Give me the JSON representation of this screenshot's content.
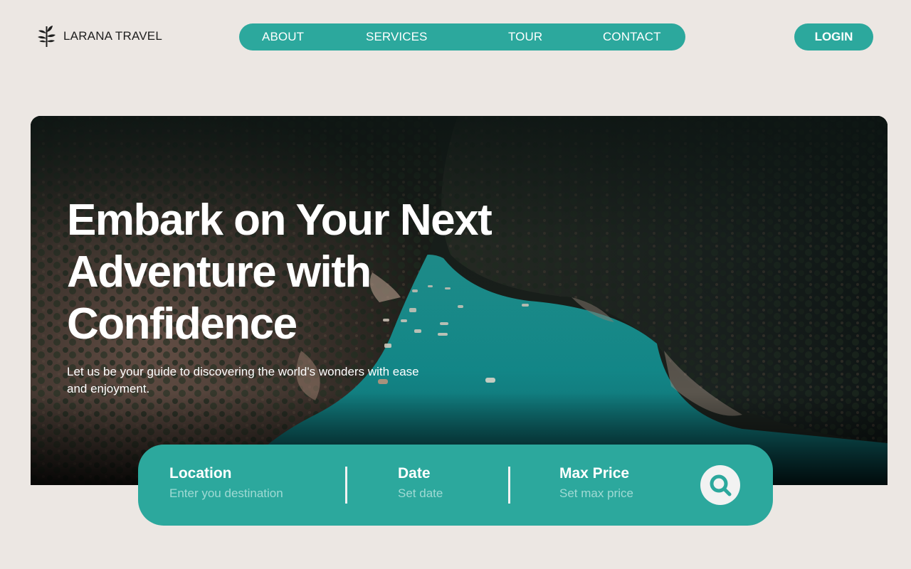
{
  "brand": {
    "name": "LARANA TRAVEL",
    "logo_icon": "leaf-branch-icon"
  },
  "nav": {
    "items": [
      {
        "label": "ABOUT"
      },
      {
        "label": "SERVICES"
      },
      {
        "label": "TOUR"
      },
      {
        "label": "CONTACT"
      }
    ]
  },
  "header": {
    "login_label": "LOGIN"
  },
  "hero": {
    "title": "Embark on Your Next Adventure with Confidence",
    "subtitle": "Let us be your guide to discovering the world's wonders with ease and enjoyment.",
    "image_description": "aerial view of turquoise river in a rocky forested canyon with small boats"
  },
  "search": {
    "fields": [
      {
        "label": "Location",
        "placeholder": "Enter you destination",
        "value": ""
      },
      {
        "label": "Date",
        "placeholder": "Set date",
        "value": ""
      },
      {
        "label": "Max Price",
        "placeholder": "Set max price",
        "value": ""
      }
    ],
    "button_icon": "search-icon"
  },
  "colors": {
    "accent": "#2ca89d",
    "background": "#ece7e3",
    "placeholder": "#9fdad4",
    "search_button_bg": "#f2f2f2"
  }
}
